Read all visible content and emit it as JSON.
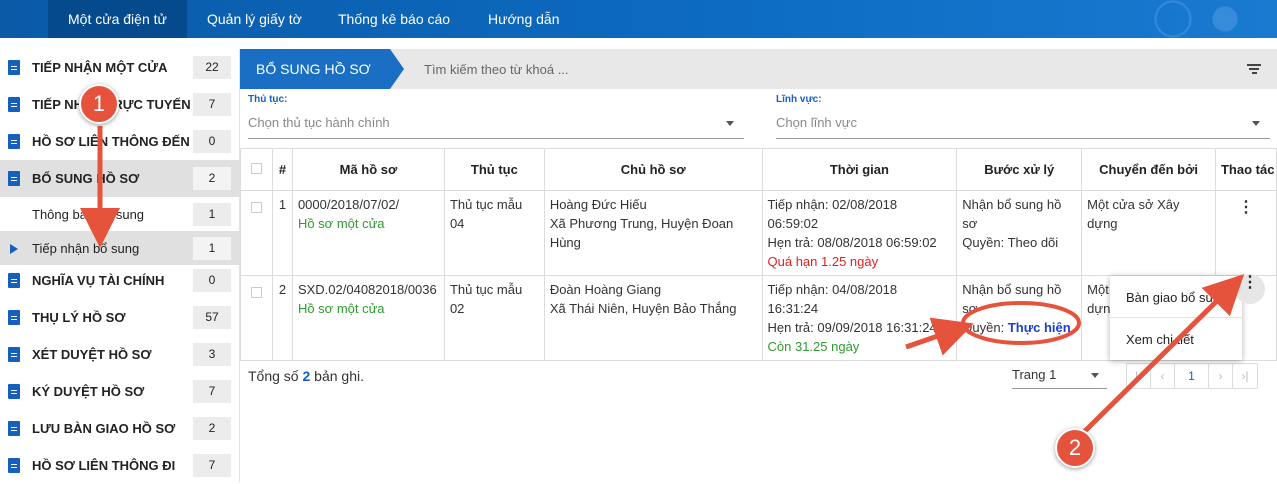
{
  "nav": {
    "items": [
      "Một cửa điện tử",
      "Quản lý giấy tờ",
      "Thống kê báo cáo",
      "Hướng dẫn"
    ]
  },
  "sidebar": {
    "items": [
      {
        "label": "TIẾP NHẬN MỘT CỬA",
        "count": "22"
      },
      {
        "label": "TIẾP NHẬN TRỰC TUYẾN",
        "count": "7"
      },
      {
        "label": "HỒ SƠ LIÊN THÔNG ĐẾN",
        "count": "0"
      },
      {
        "label": "BỔ SUNG HỒ SƠ",
        "count": "2"
      },
      {
        "label": "Thông báo bổ sung",
        "count": "1"
      },
      {
        "label": "Tiếp nhận bổ sung",
        "count": "1"
      },
      {
        "label": "NGHĨA VỤ TÀI CHÍNH",
        "count": "0"
      },
      {
        "label": "THỤ LÝ HỒ SƠ",
        "count": "57"
      },
      {
        "label": "XÉT DUYỆT HỒ SƠ",
        "count": "3"
      },
      {
        "label": "KÝ DUYỆT HỒ SƠ",
        "count": "7"
      },
      {
        "label": "LƯU BÀN GIAO HỒ SƠ",
        "count": "2"
      },
      {
        "label": "HỒ SƠ LIÊN THÔNG ĐI",
        "count": "7"
      }
    ]
  },
  "main": {
    "title": "BỔ SUNG HỒ SƠ",
    "search_placeholder": "Tìm kiếm theo từ khoá ...",
    "filters": {
      "procedure_label": "Thủ tục:",
      "procedure_placeholder": "Chọn thủ tục hành chính",
      "field_label": "Lĩnh vực:",
      "field_placeholder": "Chọn lĩnh vực"
    },
    "table": {
      "headers": [
        "#",
        "Mã hồ sơ",
        "Thủ tục",
        "Chủ hồ sơ",
        "Thời gian",
        "Bước xử lý",
        "Chuyển đến bởi",
        "Thao tác"
      ],
      "rows": [
        {
          "index": "1",
          "code": "0000/2018/07/02/",
          "code_type": "Hồ sơ một cửa",
          "procedure": "Thủ tục mẫu 04",
          "owner_name": "Hoàng Đức Hiếu",
          "owner_addr": "Xã Phương Trung, Huyện Đoan Hùng",
          "received": "Tiếp nhận: 02/08/2018 06:59:02",
          "due": "Hẹn trả: 08/08/2018 06:59:02",
          "remaining": "Quá hạn 1.25 ngày",
          "step": "Nhận bổ sung hồ sơ",
          "role_label": "Quyền: ",
          "role": "Theo dõi",
          "from": "Một cửa sở Xây dựng"
        },
        {
          "index": "2",
          "code": "SXD.02/04082018/0036",
          "code_type": "Hồ sơ một cửa",
          "procedure": "Thủ tục mẫu 02",
          "owner_name": "Đoàn Hoàng Giang",
          "owner_addr": "Xã Thái Niên, Huyện Bảo Thắng",
          "received": "Tiếp nhận: 04/08/2018 16:31:24",
          "due": "Hẹn trả: 09/09/2018 16:31:24",
          "remaining": "Còn 31.25 ngày",
          "step": "Nhận bổ sung hồ sơ",
          "role_label": "Quyền: ",
          "role": "Thực hiện",
          "from": "Một cửa sở Xây dựng"
        }
      ]
    },
    "footer": {
      "total_prefix": "Tổng số ",
      "total": "2",
      "total_suffix": " bản ghi.",
      "page_select": "Trang 1",
      "current_page": "1"
    },
    "action_menu": {
      "items": [
        "Bàn giao bổ sung",
        "Xem chi tiết"
      ]
    }
  },
  "annotations": {
    "step1": "1",
    "step2": "2",
    "accent": "#e5533d"
  },
  "colors": {
    "nav_bg": "#0d6cc3",
    "primary": "#1560bd",
    "ok": "#2e9b2e",
    "overdue": "#e02020"
  }
}
